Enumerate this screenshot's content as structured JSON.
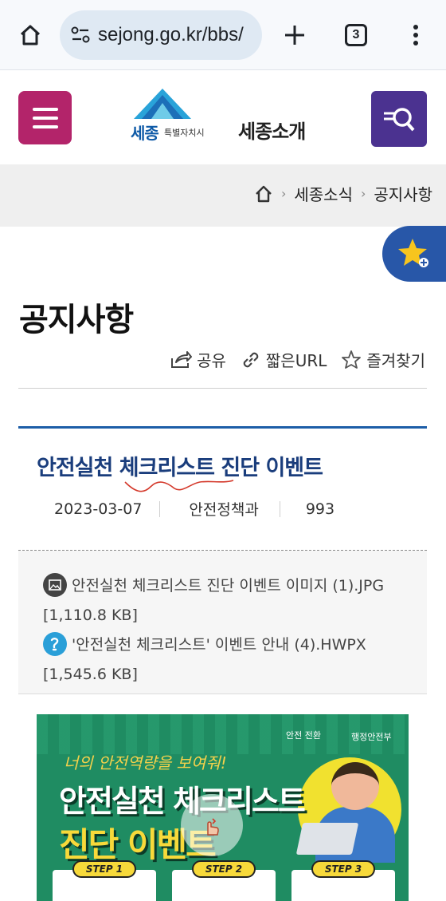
{
  "browser": {
    "url": "sejong.go.kr/bbs/",
    "tab_count": "3"
  },
  "header": {
    "logo_city": "세종",
    "logo_sub": "특별자치시",
    "section": "세종소개"
  },
  "breadcrumb": {
    "items": [
      "세종소식",
      "공지사항"
    ]
  },
  "page": {
    "title": "공지사항",
    "tools": {
      "share": "공유",
      "short_url": "짧은URL",
      "bookmark": "즐겨찾기"
    }
  },
  "post": {
    "title": "안전실천 체크리스트 진단 이벤트",
    "date": "2023-03-07",
    "department": "안전정책과",
    "views": "993",
    "attachments": [
      {
        "icon": "image-file-icon",
        "text": "안전실천 체크리스트 진단 이벤트 이미지 (1).JPG [1,110.8 KB]"
      },
      {
        "icon": "hwp-file-icon",
        "text": "'안전실천 체크리스트' 이벤트 안내 (4).HWPX [1,545.6 KB]"
      }
    ]
  },
  "poster": {
    "badge_left": "안전 전환",
    "badge_right": "행정안전부",
    "slogan": "너의 안전역량을 보여줘!",
    "line1": "안전실천 체크리스트",
    "line2": "진단 이벤트",
    "steps": [
      "STEP 1",
      "STEP 2",
      "STEP 3"
    ]
  },
  "colors": {
    "menu": "#b3246a",
    "search": "#4b3290",
    "title_blue": "#1a3d7c",
    "topline": "#1d5ea8",
    "fav": "#2857a8",
    "poster_green": "#1f8c62"
  }
}
